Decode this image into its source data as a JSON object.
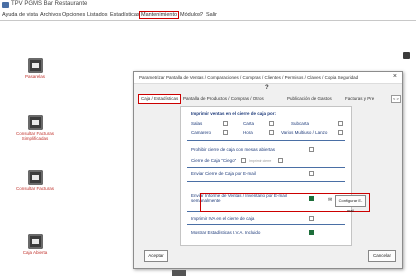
{
  "window": {
    "title": "TPV PGMS Bar Restaurante"
  },
  "menubar": [
    {
      "label": "Ayuda de vista"
    },
    {
      "label": "Archivos"
    },
    {
      "label": "Opciones"
    },
    {
      "label": "Listados"
    },
    {
      "label": "Estadísticas"
    },
    {
      "label": "Mantenimiento",
      "highlighted": true
    },
    {
      "label": "Módulos"
    },
    {
      "label": "?"
    },
    {
      "label": "Salir"
    }
  ],
  "desktop_icons": [
    {
      "label": "Pasarelas"
    },
    {
      "label": "Consultar Facturas Simplificadas"
    },
    {
      "label": "Consultar Facturas"
    },
    {
      "label": "Caja Abierta"
    }
  ],
  "dialog": {
    "title": "Parametrizar Pantalla de Ventas / Comparaciones / Compras / Clientes / Permisos / Claves / Copia Seguridad",
    "close": "×",
    "help": "?",
    "tabs": [
      {
        "label": "Caja / Estadísticas",
        "active": true
      },
      {
        "label": "Pantalla de Productos / Compras / Otros",
        "active": false
      },
      {
        "label": "Publicación de Gastos",
        "active": false
      },
      {
        "label": "Facturas y Pre",
        "active": false
      }
    ],
    "tab_scroll": "< >",
    "sections": {
      "print_header": "Imprimir ventas en el cierre de caja por:",
      "print_opts": [
        {
          "label": "Salas",
          "checked": false
        },
        {
          "label": "Carta",
          "checked": false
        },
        {
          "label": "Subcarta",
          "checked": false
        },
        {
          "label": "Camarero",
          "checked": false
        },
        {
          "label": "Hora",
          "checked": false
        },
        {
          "label": "Varios Multiuso / Lanzo",
          "checked": false
        }
      ],
      "forbid_close": {
        "label": "Prohibir cierre de caja con mesas abiertas",
        "checked": false
      },
      "close_label": "Cierre de Caja \"Ciego\"",
      "close_sub": "Imprimir cierre",
      "send_close_email": {
        "label": "Enviar Cierre de Caja por E-mail",
        "checked": false
      },
      "send_report": {
        "label": "Enviar Informe de Ventas / Inventario por E-mail semanalmente",
        "checked": true
      },
      "configure_email_button": "Configurar E-mail",
      "print_vat": {
        "label": "Imprimir IVA en el cierre de caja",
        "checked": false
      },
      "show_stats": {
        "label": "Mostrar Estadísticas I.V.A. Incluido",
        "checked": true
      }
    },
    "footer": {
      "accept": "Aceptar",
      "cancel": "Cancelar"
    }
  }
}
